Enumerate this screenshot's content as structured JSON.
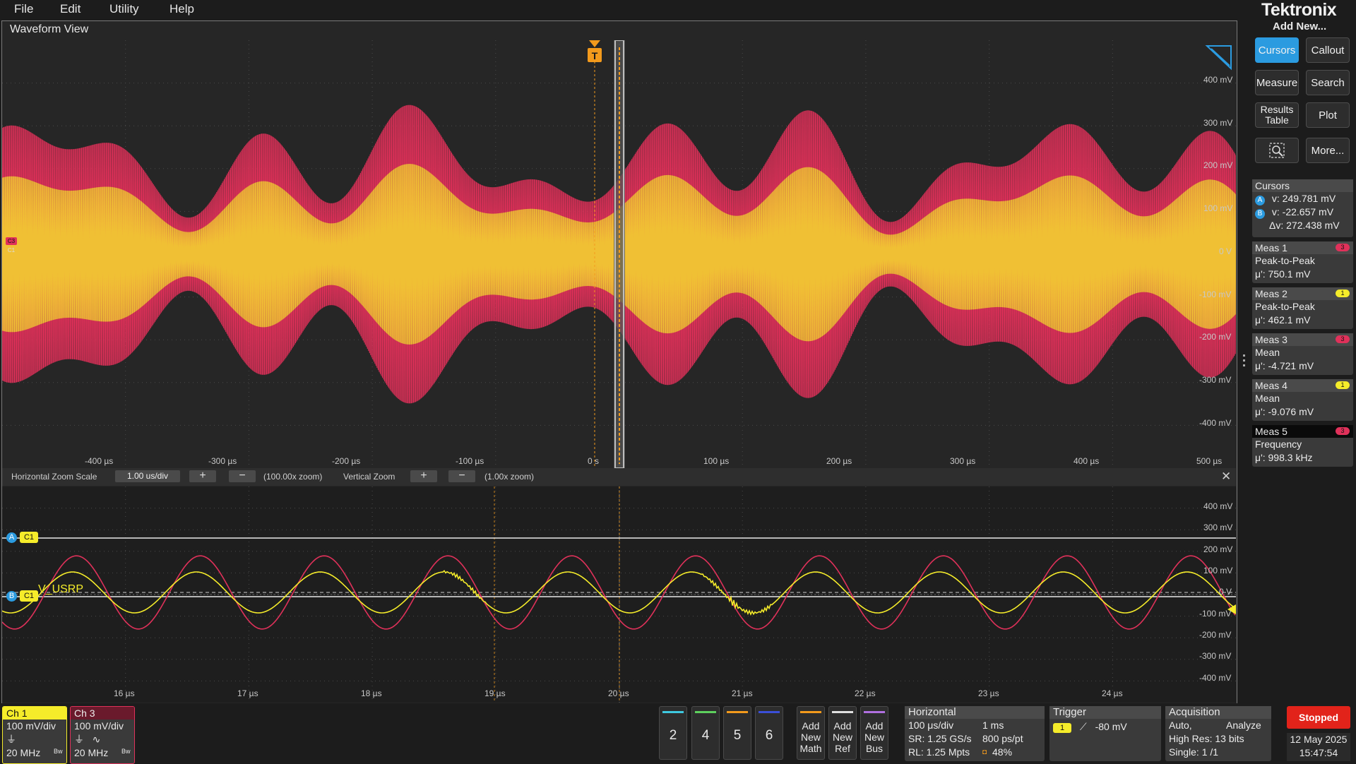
{
  "menu": [
    "File",
    "Edit",
    "Utility",
    "Help"
  ],
  "waveform_view": {
    "title": "Waveform View",
    "trigger_marker": "T",
    "y_labels": [
      "400 mV",
      "300 mV",
      "200 mV",
      "100 mV",
      "0 V",
      "-100 mV",
      "-200 mV",
      "-300 mV",
      "-400 mV"
    ],
    "x_labels": [
      "-400 µs",
      "-300 µs",
      "-200 µs",
      "-100 µs",
      "0 s",
      "100 µs",
      "200 µs",
      "300 µs",
      "400 µs",
      "500 µs"
    ],
    "ch_tags": [
      "C3",
      "C1"
    ]
  },
  "zoom_bar": {
    "hz_label": "Horizontal Zoom Scale",
    "hz_value": "1.00 us/div",
    "plus": "+",
    "minus": "−",
    "hz_zoom": "(100.00x zoom)",
    "vz_label": "Vertical Zoom",
    "vz_zoom": "(1.00x zoom)",
    "close": "✕"
  },
  "zoom_view": {
    "y_labels": [
      "400 mV",
      "300 mV",
      "200 mV",
      "100 mV",
      "0 V",
      "-100 mV",
      "-200 mV",
      "-300 mV",
      "-400 mV"
    ],
    "x_labels": [
      "16 µs",
      "17 µs",
      "18 µs",
      "19 µs",
      "20 µs",
      "21 µs",
      "22 µs",
      "23 µs",
      "24 µs"
    ],
    "cursor_a_tag": "A",
    "cursor_b_tag": "B",
    "ch_tag": "C1",
    "trace_label": "V_USRP"
  },
  "right_panel": {
    "brand": "Tektronix",
    "add_new": "Add New...",
    "buttons": [
      {
        "label": "Cursors",
        "active": true
      },
      {
        "label": "Callout"
      },
      {
        "label": "Measure"
      },
      {
        "label": "Search"
      },
      {
        "label": "Results Table"
      },
      {
        "label": "Plot"
      },
      {
        "label": "More..."
      }
    ],
    "cursors": {
      "title": "Cursors",
      "a_tag": "A",
      "a_value": "v: 249.781 mV",
      "b_tag": "B",
      "b_value": "v: -22.657 mV",
      "delta": "Δv: 272.438 mV"
    },
    "measurements": [
      {
        "title": "Meas 1",
        "badge": "3",
        "type": "Peak-to-Peak",
        "value": "μ': 750.1 mV"
      },
      {
        "title": "Meas 2",
        "badge": "1",
        "type": "Peak-to-Peak",
        "value": "μ': 462.1 mV"
      },
      {
        "title": "Meas 3",
        "badge": "3",
        "type": "Mean",
        "value": "μ': -4.721 mV"
      },
      {
        "title": "Meas 4",
        "badge": "1",
        "type": "Mean",
        "value": "μ': -9.076 mV"
      },
      {
        "title": "Meas 5",
        "badge": "3",
        "type": "Frequency",
        "value": "μ': 998.3 kHz"
      }
    ]
  },
  "channels": [
    {
      "name": "Ch 1",
      "scale": "100 mV/div",
      "bw": "20 MHz",
      "bw_tag": "Bw"
    },
    {
      "name": "Ch 3",
      "scale": "100 mV/div",
      "bw": "20 MHz",
      "bw_tag": "Bw"
    }
  ],
  "channel_buttons": [
    "2",
    "4",
    "5",
    "6"
  ],
  "add_buttons": [
    {
      "line1": "Add",
      "line2": "New",
      "line3": "Math"
    },
    {
      "line1": "Add",
      "line2": "New",
      "line3": "Ref"
    },
    {
      "line1": "Add",
      "line2": "New",
      "line3": "Bus"
    }
  ],
  "horizontal": {
    "title": "Horizontal",
    "scale": "100 μs/div",
    "record": "1 ms",
    "sr": "SR: 1.25 GS/s",
    "pt": "800 ps/pt",
    "rl": "RL: 1.25 Mpts",
    "pct": "48%"
  },
  "trigger": {
    "title": "Trigger",
    "source": "1",
    "level": "-80 mV"
  },
  "acquisition": {
    "title": "Acquisition",
    "mode": "Auto,",
    "analyze": "Analyze",
    "res": "High Res: 13 bits",
    "single": "Single: 1 /1"
  },
  "status": "Stopped",
  "date": "12 May 2025",
  "time": "15:47:54",
  "colors": {
    "ch1": "#f5ec2a",
    "ch3": "#e0315a",
    "accent": "#2b9be0",
    "trigger": "#f39a1c",
    "stopped": "#e2231a"
  }
}
